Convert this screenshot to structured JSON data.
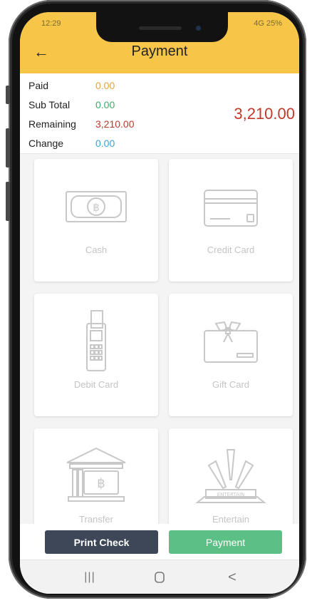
{
  "status_bar": {
    "time": "12:29",
    "right": "4G 25%"
  },
  "header": {
    "title": "Payment",
    "back_icon": "arrow-left-icon"
  },
  "summary": {
    "rows": [
      {
        "label": "Paid",
        "value": "0.00",
        "color": "#e6a23c"
      },
      {
        "label": "Sub Total",
        "value": "0.00",
        "color": "#41a86a"
      },
      {
        "label": "Remaining",
        "value": "3,210.00",
        "color": "#c0392b"
      },
      {
        "label": "Change",
        "value": "0.00",
        "color": "#3aa3d8"
      }
    ],
    "total": "3,210.00"
  },
  "methods": [
    {
      "label": "Cash",
      "icon": "cash-banknote-icon"
    },
    {
      "label": "Credit Card",
      "icon": "credit-card-icon"
    },
    {
      "label": "Debit Card",
      "icon": "card-terminal-icon"
    },
    {
      "label": "Gift Card",
      "icon": "gift-card-icon"
    },
    {
      "label": "Transfer",
      "icon": "bank-transfer-icon"
    },
    {
      "label": "Entertain",
      "icon": "entertain-party-icon"
    }
  ],
  "actions": {
    "print": "Print Check",
    "payment": "Payment"
  },
  "navbar": {
    "recent": "|||",
    "home": "O",
    "back": "<"
  },
  "colors": {
    "header": "#f7c547",
    "total": "#c0392b",
    "print_button": "#3d4758",
    "payment_button": "#5cbf86"
  }
}
